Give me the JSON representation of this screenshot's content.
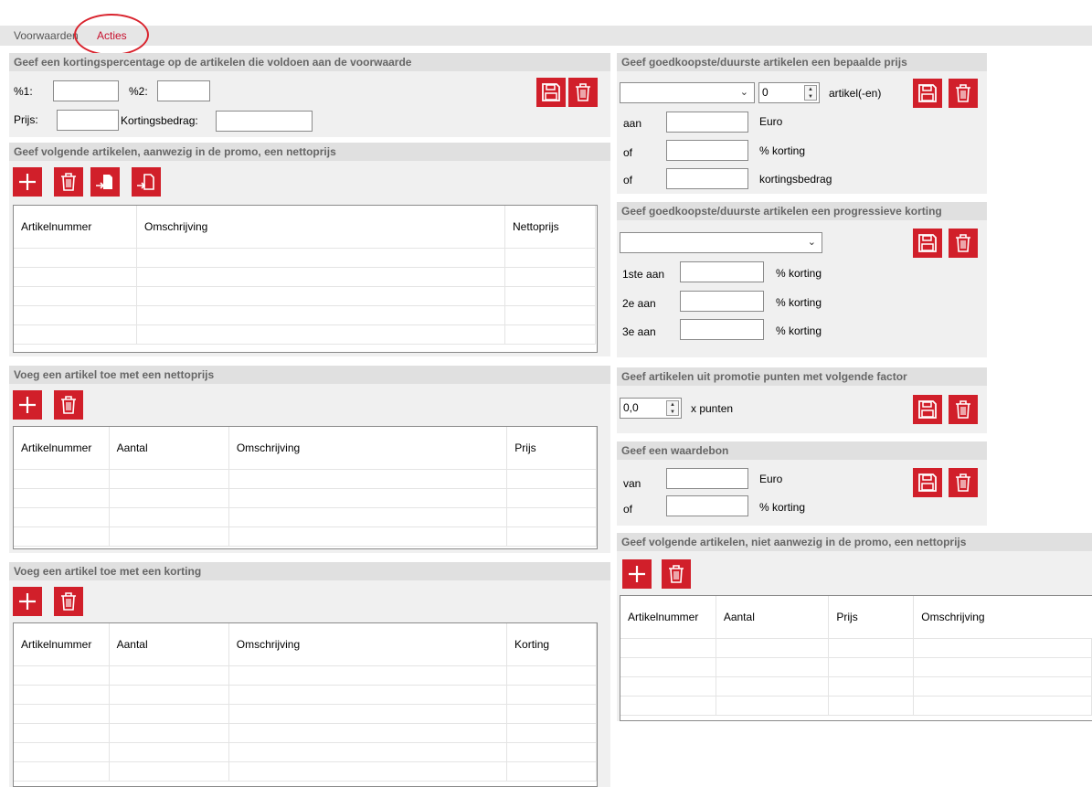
{
  "tabs": {
    "voorwaarden": "Voorwaarden",
    "acties": "Acties"
  },
  "colors": {
    "accent": "#d11f2a",
    "panel_bg": "#f0f0f0",
    "title_bg": "#e0e0e0"
  },
  "icons": {
    "save": "floppy-disk-icon",
    "delete": "trash-icon",
    "add": "plus-icon",
    "import": "import-icon",
    "export": "export-icon"
  },
  "panel_korting": {
    "title": "Geef een kortingspercentage op de artikelen die voldoen aan de voorwaarde",
    "pct1_label": "%1:",
    "pct1_value": "",
    "pct2_label": "%2:",
    "pct2_value": "",
    "prijs_label": "Prijs:",
    "prijs_value": "",
    "kortingsbedrag_label": "Kortingsbedrag:",
    "kortingsbedrag_value": ""
  },
  "panel_nettoprijs_promo": {
    "title": "Geef volgende artikelen, aanwezig in de promo, een nettoprijs",
    "columns": [
      "Artikelnummer",
      "Omschrijving",
      "Nettoprijs"
    ]
  },
  "panel_artikel_nettoprijs": {
    "title": "Voeg een artikel toe met een nettoprijs",
    "columns": [
      "Artikelnummer",
      "Aantal",
      "Omschrijving",
      "Prijs"
    ]
  },
  "panel_artikel_korting": {
    "title": "Voeg een artikel toe met een korting",
    "columns": [
      "Artikelnummer",
      "Aantal",
      "Omschrijving",
      "Korting"
    ]
  },
  "panel_bepaalde_prijs": {
    "title": "Geef goedkoopste/duurste artikelen een bepaalde prijs",
    "select_value": "",
    "count_value": "0",
    "artikel_label": "artikel(-en)",
    "aan_label": "aan",
    "euro_label": "Euro",
    "of1_label": "of",
    "pct_korting_label": "% korting",
    "of2_label": "of",
    "kortingsbedrag_label": "kortingsbedrag"
  },
  "panel_progressief": {
    "title": "Geef goedkoopste/duurste artikelen een progressieve korting",
    "select_value": "",
    "row1_label": "1ste aan",
    "row1_suffix": "% korting",
    "row2_label": "2e aan",
    "row2_suffix": "% korting",
    "row3_label": "3e aan",
    "row3_suffix": "% korting"
  },
  "panel_punten": {
    "title": "Geef artikelen uit promotie punten met volgende factor",
    "factor_value": "0,0",
    "suffix": "x punten"
  },
  "panel_waardebon": {
    "title": "Geef een waardebon",
    "van_label": "van",
    "euro_label": "Euro",
    "of_label": "of",
    "pct_korting_label": "% korting"
  },
  "panel_niet_aanwezig": {
    "title": "Geef volgende artikelen, niet aanwezig in de promo, een nettoprijs",
    "columns": [
      "Artikelnummer",
      "Aantal",
      "Prijs",
      "Omschrijving"
    ]
  }
}
